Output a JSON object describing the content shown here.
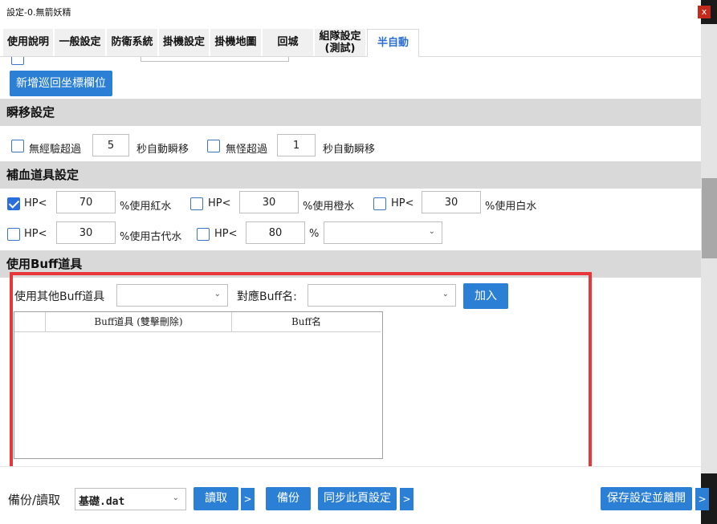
{
  "window": {
    "title": "設定-0.無箭妖精",
    "close_glyph": "x"
  },
  "tabs": [
    {
      "label": "使用說明"
    },
    {
      "label": "一般設定"
    },
    {
      "label": "防衛系統"
    },
    {
      "label": "掛機設定"
    },
    {
      "label": "掛機地圖"
    },
    {
      "label": "回城"
    },
    {
      "label_line1": "組隊設定",
      "label_line2": "(測試)"
    },
    {
      "label": "半自動",
      "active": true
    }
  ],
  "patrol": {
    "add_button": "新增巡回坐標欄位"
  },
  "teleport": {
    "header": "瞬移設定",
    "no_exp_label": "無經驗超過",
    "no_exp_value": "5",
    "no_exp_suffix": "秒自動瞬移",
    "no_monster_label": "無怪超過",
    "no_monster_value": "1",
    "no_monster_suffix": "秒自動瞬移"
  },
  "potion": {
    "header": "補血道具設定",
    "rows": [
      {
        "checked": true,
        "prefix": "HP<",
        "value": "70",
        "suffix": "%使用紅水"
      },
      {
        "checked": false,
        "prefix": "HP<",
        "value": "30",
        "suffix": "%使用橙水"
      },
      {
        "checked": false,
        "prefix": "HP<",
        "value": "30",
        "suffix": "%使用白水"
      },
      {
        "checked": false,
        "prefix": "HP<",
        "value": "30",
        "suffix": "%使用古代水"
      },
      {
        "checked": false,
        "prefix": "HP<",
        "value": "80",
        "suffix": "%",
        "dropdown": ""
      }
    ]
  },
  "buff": {
    "header": "使用Buff道具",
    "other_label": "使用其他Buff道具",
    "other_value": "",
    "name_label": "對應Buff名:",
    "name_value": "",
    "add_button": "加入",
    "columns": [
      "",
      "Buff道具 (雙擊刪除)",
      "Buff名"
    ]
  },
  "footer": {
    "backup_label": "備份/讀取",
    "file_value": "基礎.dat",
    "read_button": "讀取",
    "backup_button": "備份",
    "sync_button": "同步此頁設定",
    "save_button": "保存設定並離開",
    "arrow": ">"
  },
  "icons": {
    "dropdown": "chevron-down-icon",
    "checkmark": "checkmark-icon"
  },
  "colors": {
    "accent": "#2b7fd4",
    "highlight_box": "#e8373a",
    "section_bg": "#d9d9d9"
  }
}
